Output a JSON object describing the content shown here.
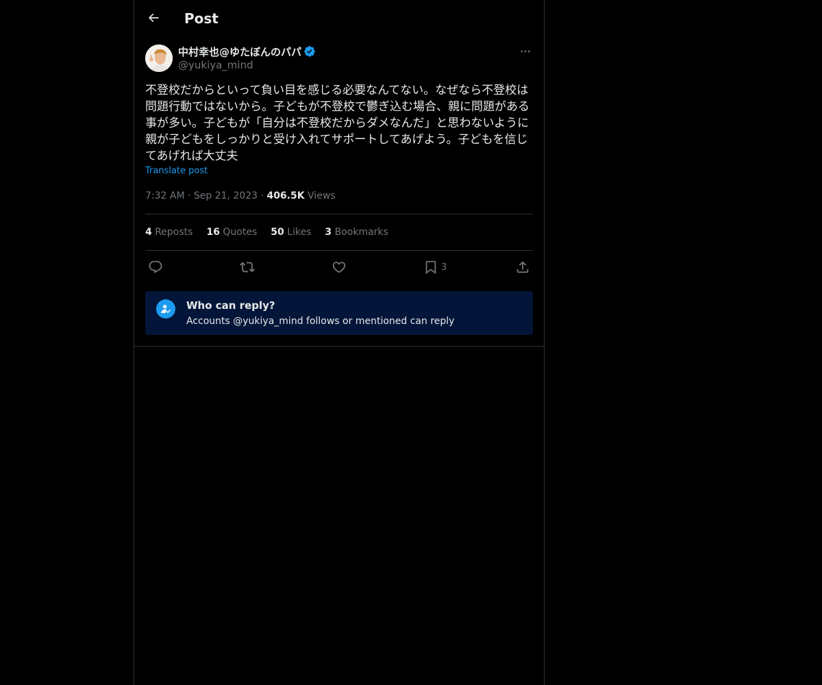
{
  "header": {
    "title": "Post",
    "back_icon": "arrow-left-icon"
  },
  "post": {
    "author": {
      "display_name": "中村幸也@ゆたぼんのパパ",
      "handle": "@yukiya_mind",
      "verified": true
    },
    "text": "不登校だからといって負い目を感じる必要なんてない。なぜなら不登校は問題行動ではないから。子どもが不登校で鬱ぎ込む場合、親に問題がある事が多い。子どもが「自分は不登校だからダメなんだ」と思わないように親が子どもをしっかりと受け入れてサポートしてあげよう。子どもを信じてあげれば大丈夫",
    "translate_label": "Translate post",
    "time": "7:32 AM",
    "separator": "·",
    "date": "Sep 21, 2023",
    "views_count": "406.5K",
    "views_label": "Views"
  },
  "stats": {
    "reposts_count": "4",
    "reposts_label": "Reposts",
    "quotes_count": "16",
    "quotes_label": "Quotes",
    "likes_count": "50",
    "likes_label": "Likes",
    "bookmarks_count": "3",
    "bookmarks_label": "Bookmarks"
  },
  "actions": {
    "bookmark_count": "3"
  },
  "reply_restriction": {
    "title": "Who can reply?",
    "subtitle": "Accounts @yukiya_mind follows or mentioned can reply"
  },
  "colors": {
    "background": "#000000",
    "text": "#e7e9ea",
    "muted": "#71767b",
    "accent": "#1d9bf0",
    "reply_box": "#031639",
    "border": "#2f3336"
  }
}
